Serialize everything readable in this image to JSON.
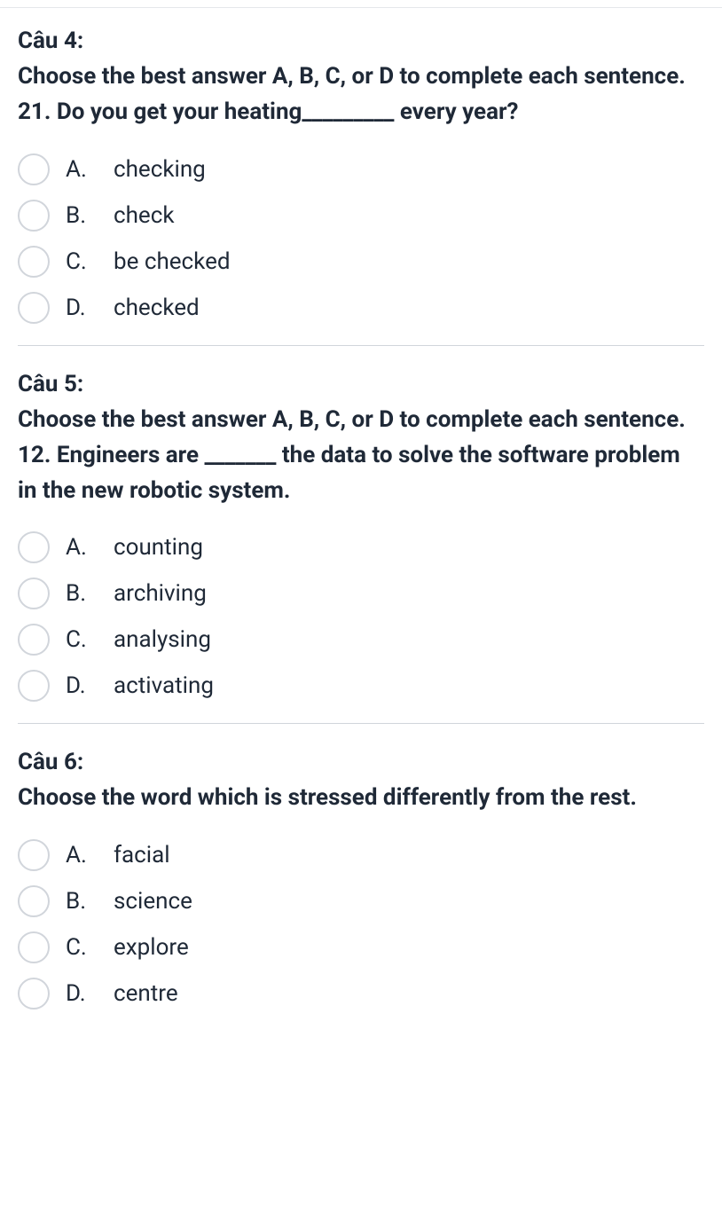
{
  "questions": [
    {
      "label": "Câu 4:",
      "instruction": "Choose the best answer A, B, C, or D to complete each sentence.",
      "prompt": "21. Do you get your heating_________ every year?",
      "options": [
        {
          "letter": "A.",
          "text": "checking"
        },
        {
          "letter": "B.",
          "text": "check"
        },
        {
          "letter": "C.",
          "text": "be checked"
        },
        {
          "letter": "D.",
          "text": "checked"
        }
      ]
    },
    {
      "label": "Câu 5:",
      "instruction": "Choose the best answer A, B, C, or D to complete each sentence.",
      "prompt": "12. Engineers are _______ the data to solve the software problem in the new robotic system.",
      "options": [
        {
          "letter": "A.",
          "text": "counting"
        },
        {
          "letter": "B.",
          "text": "archiving"
        },
        {
          "letter": "C.",
          "text": "analysing"
        },
        {
          "letter": "D.",
          "text": "activating"
        }
      ]
    },
    {
      "label": "Câu 6:",
      "instruction": "Choose the word which is stressed differently from the rest.",
      "prompt": "",
      "options": [
        {
          "letter": "A.",
          "text": "facial"
        },
        {
          "letter": "B.",
          "text": "science"
        },
        {
          "letter": "C.",
          "text": "explore"
        },
        {
          "letter": "D.",
          "text": "centre"
        }
      ]
    }
  ]
}
